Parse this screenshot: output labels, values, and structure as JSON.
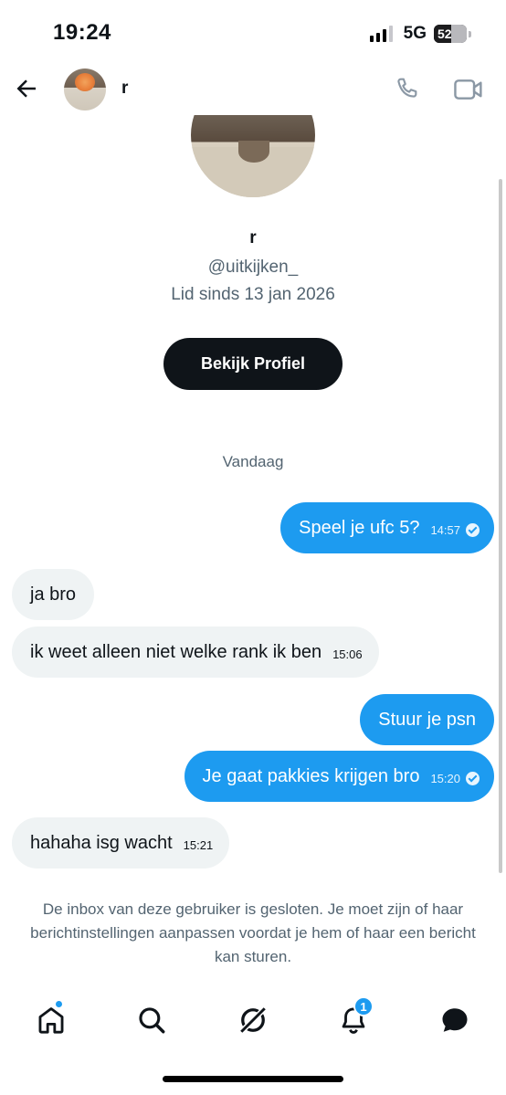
{
  "status_bar": {
    "time": "19:24",
    "network": "5G",
    "battery": "52"
  },
  "header": {
    "name": "r",
    "back_icon": "arrow-left-icon",
    "call_icon": "phone-icon",
    "video_icon": "video-camera-icon"
  },
  "profile": {
    "name": "r",
    "handle": "@uitkijken_",
    "joined": "Lid sinds 13 jan 2026",
    "view_profile_label": "Bekijk Profiel"
  },
  "conversation": {
    "date_separator": "Vandaag",
    "messages": [
      {
        "direction": "out",
        "text": "Speel je ufc 5?",
        "time": "14:57",
        "read": true
      },
      {
        "direction": "in",
        "text": "ja bro",
        "time": ""
      },
      {
        "direction": "in",
        "text": "ik weet alleen niet welke rank ik ben",
        "time": "15:06"
      },
      {
        "direction": "out",
        "text": "Stuur je psn",
        "time": ""
      },
      {
        "direction": "out",
        "text": "Je gaat pakkies krijgen bro",
        "time": "15:20",
        "read": true
      },
      {
        "direction": "in",
        "text": "hahaha isg wacht",
        "time": "15:21"
      }
    ]
  },
  "closed_inbox_note": "De inbox van deze gebruiker is gesloten. Je moet zijn of haar berichtinstellingen aanpassen voordat je hem of haar een bericht kan sturen.",
  "bottom_nav": {
    "items": [
      {
        "icon": "home-icon",
        "has_dot": true
      },
      {
        "icon": "search-icon"
      },
      {
        "icon": "grok-icon"
      },
      {
        "icon": "bell-icon",
        "badge": "1"
      },
      {
        "icon": "messages-icon"
      }
    ]
  },
  "colors": {
    "accent": "#1d9bf0",
    "incoming_bubble": "#eff3f4",
    "text": "#0f1419",
    "secondary_text": "#536471"
  }
}
